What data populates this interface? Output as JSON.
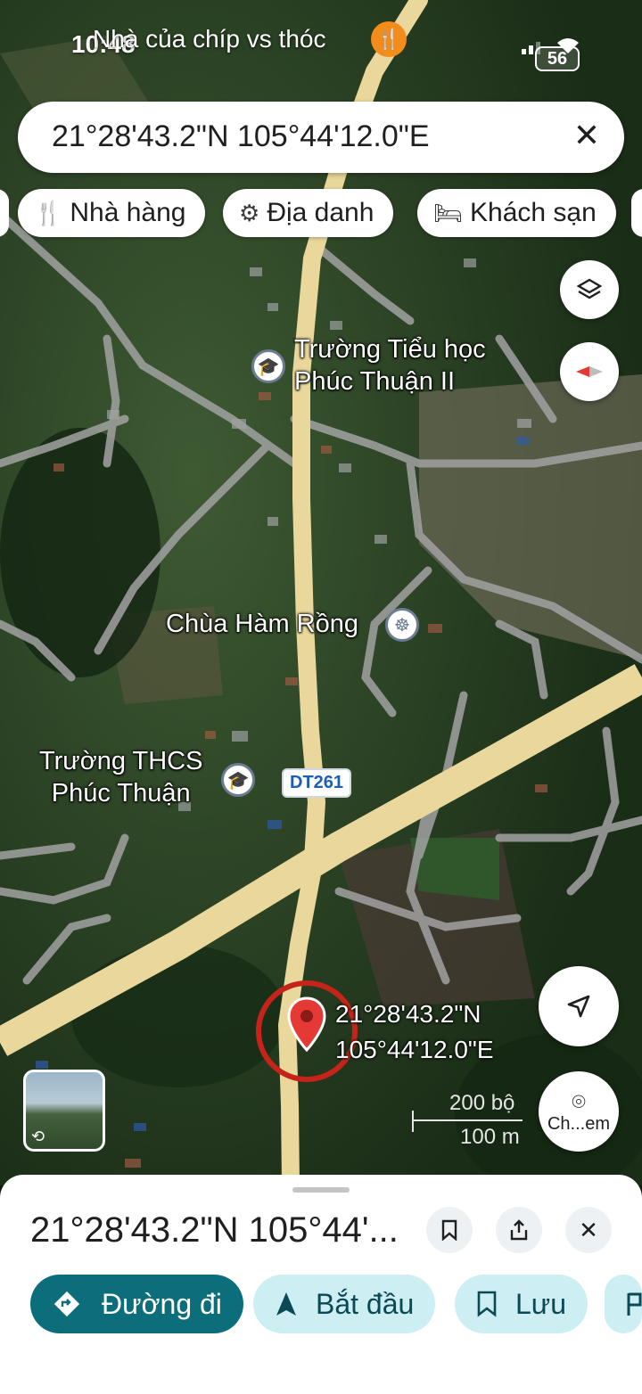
{
  "status_bar": {
    "time": "10:48",
    "caption": "Nhà của chíp vs thóc",
    "caption_icon": "restaurant-icon",
    "battery": "56"
  },
  "search": {
    "value": "21°28'43.2\"N 105°44'12.0\"E",
    "close_icon": "close-icon"
  },
  "chips": [
    {
      "label": "Nhà hàng",
      "icon": "restaurant-icon"
    },
    {
      "label": "Địa danh",
      "icon": "landmark-icon"
    },
    {
      "label": "Khách sạn",
      "icon": "hotel-icon"
    }
  ],
  "map": {
    "places": [
      {
        "name_line1": "Trường Tiểu học",
        "name_line2": "Phúc Thuận II",
        "icon": "school-icon"
      },
      {
        "name_line1": "Chùa Hàm Rồng",
        "icon": "temple-icon"
      },
      {
        "name_line1": "Trường THCS",
        "name_line2": "Phúc Thuận",
        "icon": "school-icon"
      }
    ],
    "road_label": "DT261",
    "pin_coords_line1": "21°28'43.2\"N",
    "pin_coords_line2": "105°44'12.0\"E",
    "scale_top": "200 bộ",
    "scale_bottom": "100 m",
    "camera_label": "Ch...em",
    "colors": {
      "road_major": "#e9d79b",
      "road_minor": "#9a9a9a",
      "pin": "#d93025",
      "accent": "#0b6e7a"
    }
  },
  "sheet": {
    "title": "21°28'43.2\"N 105°44'...",
    "actions": [
      {
        "label": "Đường đi",
        "icon": "directions-icon"
      },
      {
        "label": "Bắt đầu",
        "icon": "navigation-icon"
      },
      {
        "label": "Lưu",
        "icon": "bookmark-icon"
      }
    ]
  }
}
